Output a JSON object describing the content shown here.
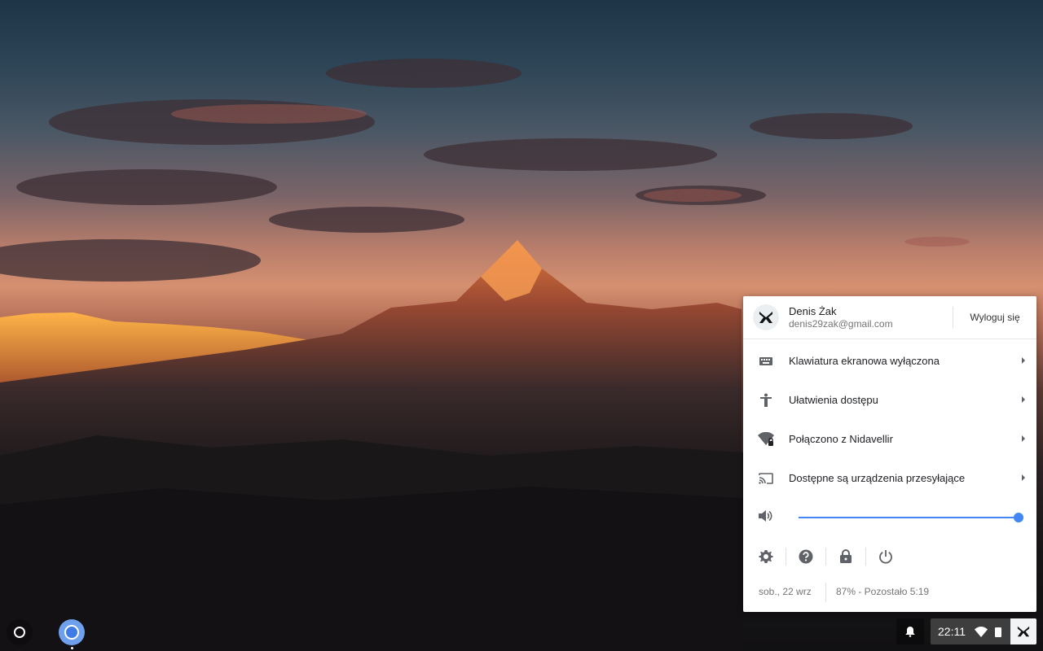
{
  "account": {
    "name": "Denis Żak",
    "email": "denis29zak@gmail.com",
    "signout_label": "Wyloguj się",
    "avatar_icon": "logo-avatar-icon"
  },
  "menu": [
    {
      "label": "Klawiatura ekranowa wyłączona",
      "icon": "keyboard-icon"
    },
    {
      "label": "Ułatwienia dostępu",
      "icon": "accessibility-icon"
    },
    {
      "label": "Połączono z Nidavellir",
      "icon": "wifi-locked-icon"
    },
    {
      "label": "Dostępne są urządzenia przesyłające",
      "icon": "cast-icon"
    }
  ],
  "volume": {
    "icon": "volume-icon",
    "level": 1.0
  },
  "quick_buttons": [
    "settings-icon",
    "help-icon",
    "lock-icon",
    "power-icon"
  ],
  "status": {
    "date": "sob., 22 wrz",
    "battery": "87% - Pozostało 5:19"
  },
  "shelf": {
    "clock": "22:11",
    "apps": [
      "launcher-icon",
      "chrome-icon"
    ],
    "tray_icons": [
      "notification-bell-icon",
      "wifi-icon",
      "battery-icon",
      "avatar-icon"
    ]
  },
  "colors": {
    "accent": "#4285f4",
    "panel_bg": "#ffffff",
    "text_primary": "#202124",
    "text_secondary": "#757575"
  }
}
